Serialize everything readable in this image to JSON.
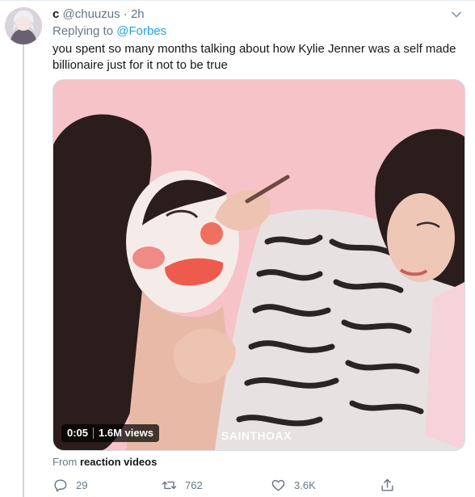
{
  "tweet": {
    "name": "c",
    "handle": "@chuuzus",
    "time": "· 2h",
    "replying_prefix": "Replying to",
    "replying_to": "@Forbes",
    "text": "you spent so many months talking about how Kylie Jenner was a self made billionaire just for it not to be true"
  },
  "video": {
    "time": "0:05",
    "views": "1.6M views",
    "watermark": "SAINTHOAX",
    "background_color": "#f6c3c8"
  },
  "source": {
    "prefix": "From",
    "name": "reaction videos"
  },
  "actions": {
    "reply_count": "29",
    "retweet_count": "762",
    "like_count": "3.6K",
    "icons": [
      "reply-icon",
      "retweet-icon",
      "like-icon",
      "share-icon"
    ]
  },
  "colors": {
    "link": "#1da1f2",
    "secondary_text": "#657786",
    "thread_line": "#ccd6dd"
  }
}
